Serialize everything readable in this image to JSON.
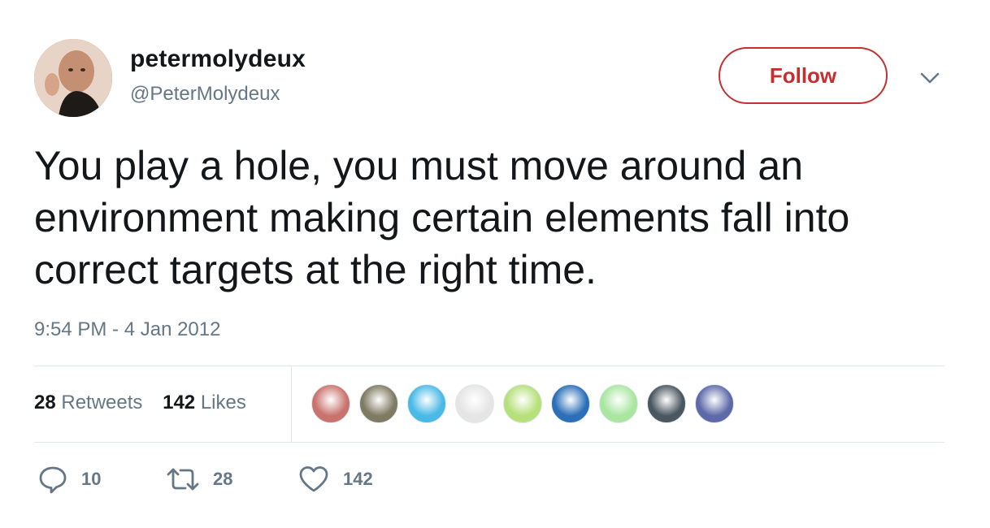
{
  "user": {
    "display_name": "petermolydeux",
    "handle": "@PeterMolydeux"
  },
  "follow_button": {
    "label": "Follow"
  },
  "tweet": {
    "text": "You play a hole, you must move around an environment making certain elements fall into correct targets at the right time.",
    "timestamp": "9:54 PM - 4 Jan 2012"
  },
  "stats": {
    "retweets_count": "28",
    "retweets_label": "Retweets",
    "likes_count": "142",
    "likes_label": "Likes"
  },
  "actions": {
    "reply_count": "10",
    "retweet_count": "28",
    "like_count": "142"
  },
  "colors": {
    "follow_accent": "#c62f2f",
    "secondary_text": "#657786",
    "primary_text": "#14171a",
    "divider": "#e1e8ed"
  },
  "icons": {
    "reply": "reply-bubble-icon",
    "retweet": "retweet-arrows-icon",
    "like": "heart-icon",
    "menu": "chevron-down-icon"
  },
  "likers": [
    {
      "name": "liker-avatar-1",
      "color": "#c9736f"
    },
    {
      "name": "liker-avatar-2",
      "color": "#7f7a62"
    },
    {
      "name": "liker-avatar-3",
      "color": "#49b9e6"
    },
    {
      "name": "liker-avatar-4",
      "color": "#e5e5e5"
    },
    {
      "name": "liker-avatar-5",
      "color": "#b6e07a"
    },
    {
      "name": "liker-avatar-6",
      "color": "#2b6fb8"
    },
    {
      "name": "liker-avatar-7",
      "color": "#a9e6a0"
    },
    {
      "name": "liker-avatar-8",
      "color": "#4a5660"
    },
    {
      "name": "liker-avatar-9",
      "color": "#5e6aa8"
    }
  ]
}
